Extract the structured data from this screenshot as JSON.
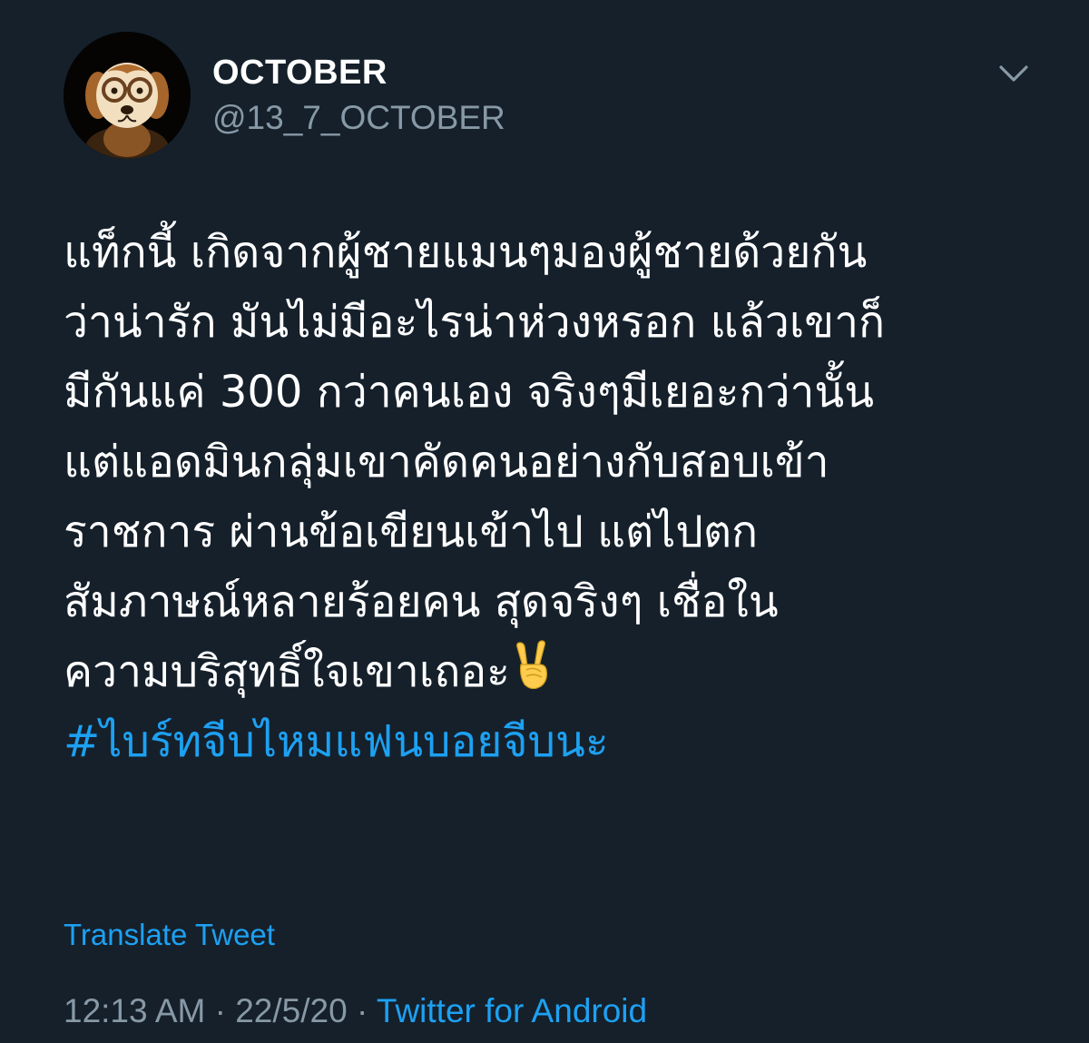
{
  "user": {
    "display_name": "OCTOBER",
    "handle": "@13_7_OCTOBER",
    "avatar_icon": "cartoon-dog-avatar"
  },
  "tweet": {
    "lines": [
      "แท็กนี้ เกิดจากผู้ชายแมนๆมองผู้ชายด้วยกัน",
      "ว่าน่ารัก มันไม่มีอะไรน่าห่วงหรอก แล้วเขาก็",
      "มีกันแค่ 300 กว่าคนเอง จริงๆมีเยอะกว่านั้น",
      "แต่แอดมินกลุ่มเขาคัดคนอย่างกับสอบเข้า",
      "ราชการ ผ่านข้อเขียนเข้าไป แต่ไปตก",
      "สัมภาษณ์หลายร้อยคน สุดจริงๆ เชื่อใน",
      "ความบริสุทธิ์ใจเขาเถอะ"
    ],
    "emoji": "victory-hand-emoji",
    "hashtag": "#ไบร์ทจีบไหมแฟนบอยจีบนะ"
  },
  "translate_label": "Translate Tweet",
  "meta": {
    "time": "12:13 AM",
    "separator": " · ",
    "date": "22/5/20",
    "source": "Twitter for Android"
  },
  "colors": {
    "background": "#15202b",
    "text": "#ffffff",
    "secondary": "#8899a6",
    "accent": "#1da1f2"
  }
}
